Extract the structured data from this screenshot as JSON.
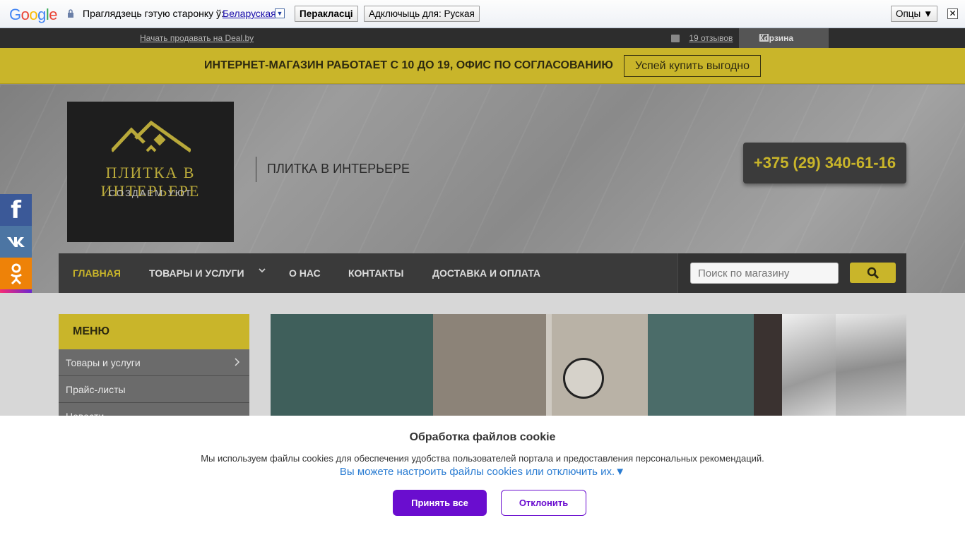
{
  "translate_bar": {
    "logo": "Google",
    "prompt": "Праглядзець гэтую старонку ў:",
    "language": "Беларуская",
    "language_arrow": "▼",
    "translate_label": "Перакласці",
    "disable_label": "Адключыць для: Руская",
    "options_label": "Опцы ▼",
    "close_label": "✕"
  },
  "topbar": {
    "sell_link": "Начать продавать на Deal.by",
    "reviews": "19 отзывов",
    "cart": "Корзина"
  },
  "announcement": {
    "text": "ИНТЕРНЕТ-МАГАЗИН РАБОТАЕТ С 10 ДО 19, ОФИС ПО СОГЛАСОВАНИЮ",
    "button": "Успей купить выгодно"
  },
  "header": {
    "logo_title": "ПЛИТКА В ИНТЕРЬЕРЕ",
    "logo_tagline": "СОЗДАЕМ УЮТ",
    "site_name": "ПЛИТКА В ИНТЕРЬЕРЕ",
    "phone": "+375 (29) 340-61-16",
    "accent_color": "#c9b52a"
  },
  "nav": {
    "items": [
      {
        "label": "ГЛАВНАЯ",
        "active": true
      },
      {
        "label": "ТОВАРЫ И УСЛУГИ",
        "active": false
      },
      {
        "label": "О НАС",
        "active": false
      },
      {
        "label": "КОНТАКТЫ",
        "active": false
      },
      {
        "label": "ДОСТАВКА И ОПЛАТА",
        "active": false
      }
    ],
    "search_placeholder": "Поиск по магазину"
  },
  "social": [
    "facebook-icon",
    "vk-icon",
    "odnoklassniki-icon",
    "instagram-icon"
  ],
  "sidebar_menu": {
    "title": "МЕНЮ",
    "items": [
      "Товары и услуги",
      "Прайс-листы",
      "Новости"
    ]
  },
  "cookie": {
    "title": "Обработка файлов cookie",
    "description": "Мы используем файлы cookies для обеспечения удобства пользователей портала и предоставления персональных рекомендаций.",
    "settings_link": "Вы можете настроить файлы cookies или отключить их.▼",
    "accept": "Принять все",
    "decline": "Отклонить",
    "button_color": "#6a0dcf"
  }
}
